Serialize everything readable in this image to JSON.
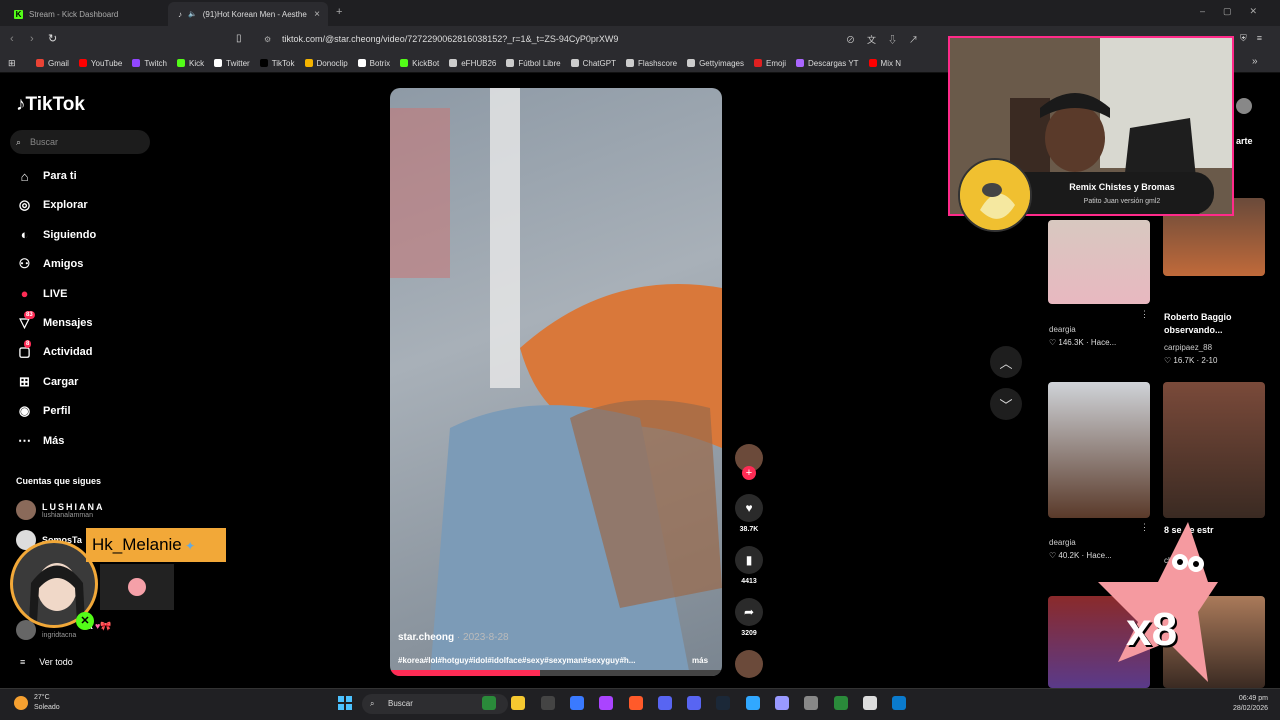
{
  "browser": {
    "tabs": [
      {
        "label": "Stream - Kick Dashboard"
      },
      {
        "label": "(91)Hot Korean Men - Aesthe"
      }
    ],
    "url": "tiktok.com/@star.cheong/video/7272290062816038152?_r=1&_t=ZS-94CyP0prXW9",
    "bookmarks": [
      "Gmail",
      "YouTube",
      "Twitch",
      "Kick",
      "Twitter",
      "TikTok",
      "Donoclip",
      "Botrix",
      "KickBot",
      "eFHUB26",
      "Fútbol Libre",
      "ChatGPT",
      "Flashscore",
      "Gettyimages",
      "Emoji",
      "Descargas YT",
      "Mix N"
    ],
    "bookmark_colors": [
      "#ea4335",
      "#ff0000",
      "#9146ff",
      "#53fc18",
      "#ffffff",
      "#000000",
      "#f5b400",
      "#ffffff",
      "#53fc18",
      "#cccccc",
      "#cccccc",
      "#cccccc",
      "#cccccc",
      "#cccccc",
      "#e02020",
      "#aa66ff",
      "#ff0000"
    ]
  },
  "tiktok": {
    "logo": "TikTok",
    "search_placeholder": "Buscar",
    "nav": [
      {
        "label": "Para ti",
        "icon": "home-icon"
      },
      {
        "label": "Explorar",
        "icon": "compass-icon"
      },
      {
        "label": "Siguiendo",
        "icon": "following-icon"
      },
      {
        "label": "Amigos",
        "icon": "friends-icon"
      },
      {
        "label": "LIVE",
        "icon": "live-icon"
      },
      {
        "label": "Mensajes",
        "icon": "messages-icon",
        "badge": "83"
      },
      {
        "label": "Actividad",
        "icon": "activity-icon",
        "badge": "8"
      },
      {
        "label": "Cargar",
        "icon": "upload-icon"
      },
      {
        "label": "Perfil",
        "icon": "profile-icon"
      },
      {
        "label": "Más",
        "icon": "more-icon"
      }
    ],
    "following_title": "Cuentas que sigues",
    "following": [
      {
        "name": "LUSHIANA",
        "handle": "lushianalamman"
      },
      {
        "name": "SomosTa",
        "handle": ""
      },
      {
        "name": "na",
        "handle": "ingridtacna"
      }
    ],
    "see_all": "Ver todo",
    "video": {
      "author": "star.cheong",
      "date": "· 2023-8-28",
      "tags": "#korea#lol#hotguy#idol#idolface#sexy#sexyman#sexyguy#h...",
      "more": "más",
      "likes": "38.7K",
      "saves": "4413",
      "shares": "3209"
    },
    "right_header_fragment": "arte",
    "right_cards": [
      {
        "user": "deargia",
        "stats": "♡ 146.3K · Hace..."
      },
      {
        "title": "Roberto Baggio observando...",
        "user": "carpipaez_88",
        "stats": "♡ 16.7K · 2-10"
      },
      {
        "user": "deargia",
        "stats": "♡ 40.2K · Hace..."
      },
      {
        "title": "8 se        de estr",
        "user": "ch",
        "stats": ""
      }
    ]
  },
  "overlays": {
    "alert_title": "Remix Chistes y Bromas",
    "alert_subtitle": "Patito Juan versión gml2",
    "melanie_name": "Hk_Melanie",
    "multiplier": "x8"
  },
  "taskbar": {
    "temperature": "27°C",
    "weather": "Soleado",
    "search": "Buscar",
    "time": "06:49 pm",
    "date": "28/02/2026"
  }
}
